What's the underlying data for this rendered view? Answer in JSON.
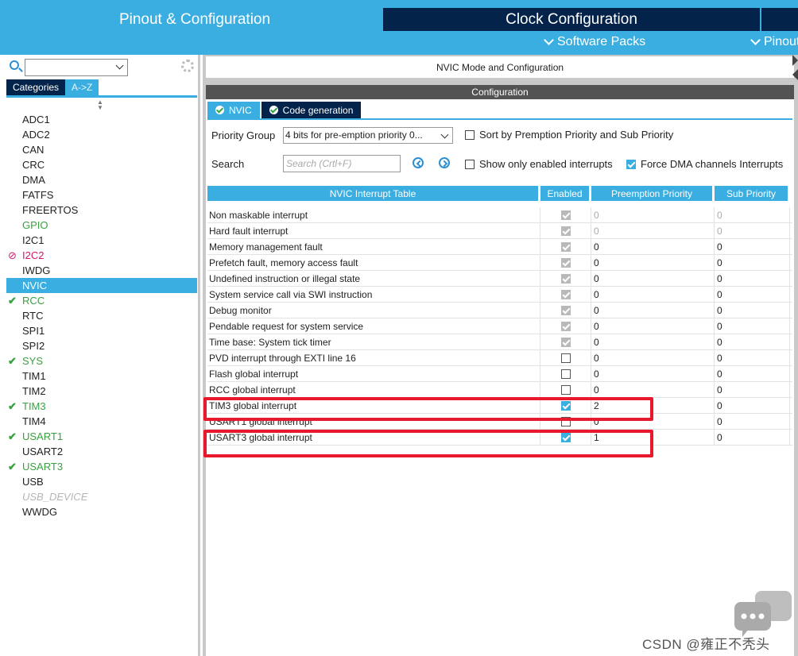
{
  "top_tabs": {
    "pinout": "Pinout & Configuration",
    "clock": "Clock Configuration"
  },
  "sub_menus": {
    "software_packs": "Software Packs",
    "pinout": "Pinout"
  },
  "left_panel": {
    "search_value": "",
    "tabs": [
      "Categories",
      "A->Z"
    ],
    "active_tab": "Categories",
    "peripherals": [
      {
        "label": "ADC1",
        "status": "none"
      },
      {
        "label": "ADC2",
        "status": "none"
      },
      {
        "label": "CAN",
        "status": "none"
      },
      {
        "label": "CRC",
        "status": "none"
      },
      {
        "label": "DMA",
        "status": "none"
      },
      {
        "label": "FATFS",
        "status": "none"
      },
      {
        "label": "FREERTOS",
        "status": "none"
      },
      {
        "label": "GPIO",
        "status": "green"
      },
      {
        "label": "I2C1",
        "status": "none"
      },
      {
        "label": "I2C2",
        "status": "blocked"
      },
      {
        "label": "IWDG",
        "status": "none"
      },
      {
        "label": "NVIC",
        "status": "selected"
      },
      {
        "label": "RCC",
        "status": "configured"
      },
      {
        "label": "RTC",
        "status": "none"
      },
      {
        "label": "SPI1",
        "status": "none"
      },
      {
        "label": "SPI2",
        "status": "none"
      },
      {
        "label": "SYS",
        "status": "configured"
      },
      {
        "label": "TIM1",
        "status": "none"
      },
      {
        "label": "TIM2",
        "status": "none"
      },
      {
        "label": "TIM3",
        "status": "configured"
      },
      {
        "label": "TIM4",
        "status": "none"
      },
      {
        "label": "USART1",
        "status": "configured"
      },
      {
        "label": "USART2",
        "status": "none"
      },
      {
        "label": "USART3",
        "status": "configured"
      },
      {
        "label": "USB",
        "status": "none"
      },
      {
        "label": "USB_DEVICE",
        "status": "disabled"
      },
      {
        "label": "WWDG",
        "status": "none"
      }
    ]
  },
  "main": {
    "mode_title": "NVIC Mode and Configuration",
    "config_title": "Configuration",
    "sub_tabs": [
      "NVIC",
      "Code generation"
    ],
    "active_sub_tab": "NVIC",
    "priority_group_label": "Priority Group",
    "priority_group_value": "4 bits for pre-emption priority 0...",
    "sort_label": "Sort by Premption Priority and Sub Priority",
    "sort_checked": false,
    "search_label": "Search",
    "search_placeholder": "Search (Crtl+F)",
    "show_enabled_label": "Show only enabled interrupts",
    "show_enabled_checked": false,
    "force_dma_label": "Force DMA channels Interrupts",
    "force_dma_checked": true
  },
  "table": {
    "headers": [
      "NVIC Interrupt Table",
      "Enabled",
      "Preemption Priority",
      "Sub Priority"
    ],
    "rows": [
      {
        "name": "Non maskable interrupt",
        "enabled": true,
        "locked": true,
        "preemption": "0",
        "sub": "0",
        "editable": false
      },
      {
        "name": "Hard fault interrupt",
        "enabled": true,
        "locked": true,
        "preemption": "0",
        "sub": "0",
        "editable": false
      },
      {
        "name": "Memory management fault",
        "enabled": true,
        "locked": true,
        "preemption": "0",
        "sub": "0",
        "editable": true
      },
      {
        "name": "Prefetch fault, memory access fault",
        "enabled": true,
        "locked": true,
        "preemption": "0",
        "sub": "0",
        "editable": true
      },
      {
        "name": "Undefined instruction or illegal state",
        "enabled": true,
        "locked": true,
        "preemption": "0",
        "sub": "0",
        "editable": true
      },
      {
        "name": "System service call via SWI instruction",
        "enabled": true,
        "locked": true,
        "preemption": "0",
        "sub": "0",
        "editable": true
      },
      {
        "name": "Debug monitor",
        "enabled": true,
        "locked": true,
        "preemption": "0",
        "sub": "0",
        "editable": true
      },
      {
        "name": "Pendable request for system service",
        "enabled": true,
        "locked": true,
        "preemption": "0",
        "sub": "0",
        "editable": true
      },
      {
        "name": "Time base: System tick timer",
        "enabled": true,
        "locked": true,
        "preemption": "0",
        "sub": "0",
        "editable": true
      },
      {
        "name": "PVD interrupt through EXTI line 16",
        "enabled": false,
        "locked": false,
        "preemption": "0",
        "sub": "0",
        "editable": true
      },
      {
        "name": "Flash global interrupt",
        "enabled": false,
        "locked": false,
        "preemption": "0",
        "sub": "0",
        "editable": true
      },
      {
        "name": "RCC global interrupt",
        "enabled": false,
        "locked": false,
        "preemption": "0",
        "sub": "0",
        "editable": true
      },
      {
        "name": "TIM3 global interrupt",
        "enabled": true,
        "locked": false,
        "preemption": "2",
        "sub": "0",
        "editable": true
      },
      {
        "name": "USART1 global interrupt",
        "enabled": false,
        "locked": false,
        "preemption": "0",
        "sub": "0",
        "editable": true
      },
      {
        "name": "USART3 global interrupt",
        "enabled": true,
        "locked": false,
        "preemption": "1",
        "sub": "0",
        "editable": true
      }
    ]
  },
  "watermark": "CSDN @雍正不秃头",
  "colors": {
    "accent": "#3aaee0",
    "navy": "#03234b",
    "ok_green": "#3aa141",
    "blocked_pink": "#d3146d",
    "highlight_red": "#e8192c"
  }
}
